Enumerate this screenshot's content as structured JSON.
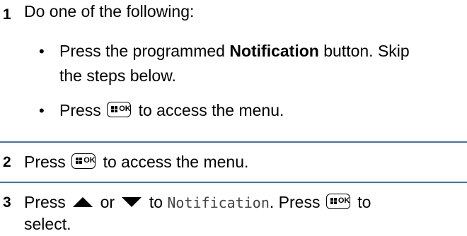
{
  "steps": [
    {
      "number": "1",
      "text": "Do one of the following:",
      "bullets": [
        {
          "symbol": "•",
          "line1_pre": "Press the programmed ",
          "line1_bold": "Notification",
          "line1_post": " button. Skip",
          "line2": "the steps below."
        },
        {
          "symbol": "•",
          "pre": "Press",
          "post": "to access the menu."
        }
      ]
    },
    {
      "number": "2",
      "pre": "Press",
      "post": "to access the menu."
    },
    {
      "number": "3",
      "pre": "Press",
      "or": "or",
      "to": "to",
      "menu_item": "Notification",
      "mid": ". Press",
      "post": "to",
      "line2": "select."
    }
  ],
  "icons": {
    "ok_button": "menu-ok-button-icon",
    "up": "up-arrow-icon",
    "down": "down-arrow-icon",
    "ok_label": "OK"
  },
  "colors": {
    "rule": "#3b74b5"
  }
}
